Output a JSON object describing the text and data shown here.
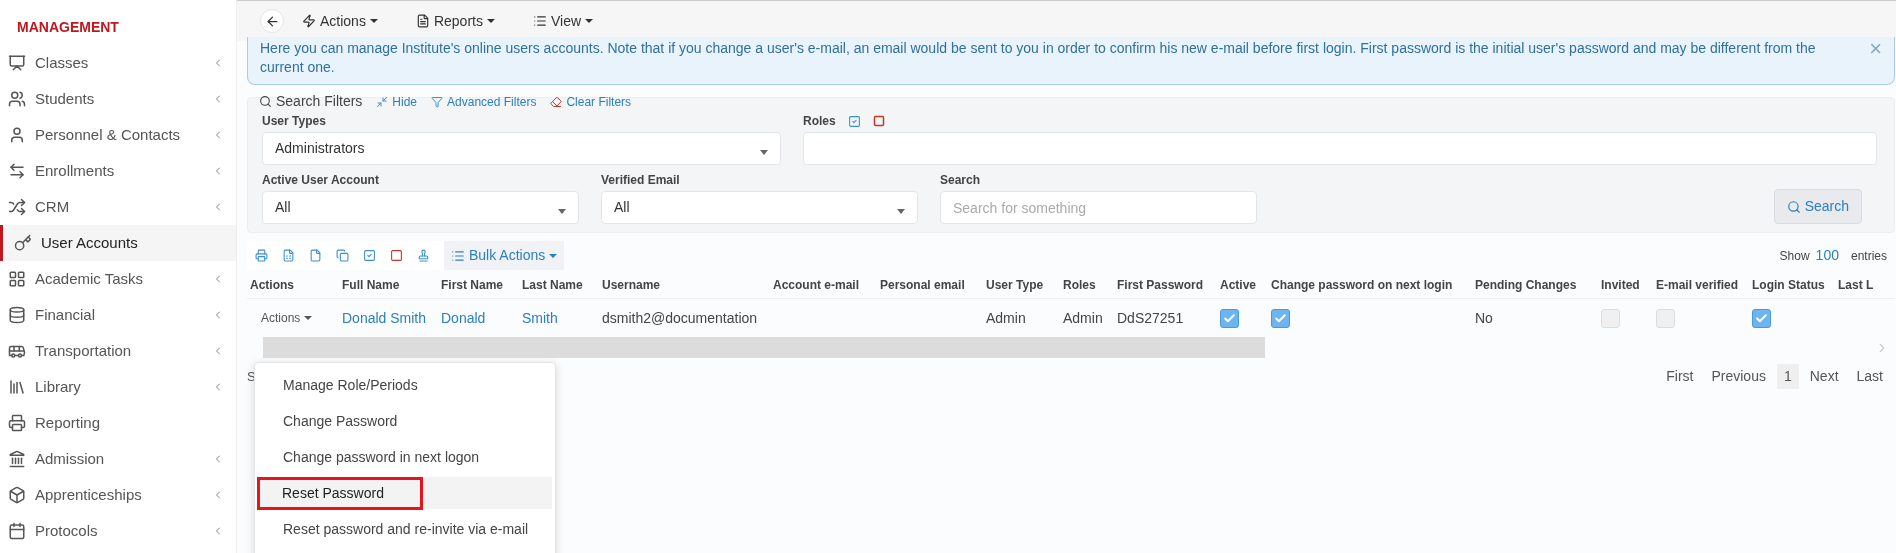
{
  "sidebar": {
    "heading": "MANAGEMENT",
    "items": [
      {
        "label": "Classes",
        "selected": false,
        "has_submenu": true
      },
      {
        "label": "Students",
        "selected": false,
        "has_submenu": true
      },
      {
        "label": "Personnel & Contacts",
        "selected": false,
        "has_submenu": true
      },
      {
        "label": "Enrollments",
        "selected": false,
        "has_submenu": true
      },
      {
        "label": "CRM",
        "selected": false,
        "has_submenu": true
      },
      {
        "label": "User Accounts",
        "selected": true,
        "has_submenu": false
      },
      {
        "label": "Academic Tasks",
        "selected": false,
        "has_submenu": true
      },
      {
        "label": "Financial",
        "selected": false,
        "has_submenu": true
      },
      {
        "label": "Transportation",
        "selected": false,
        "has_submenu": true
      },
      {
        "label": "Library",
        "selected": false,
        "has_submenu": true
      },
      {
        "label": "Reporting",
        "selected": false,
        "has_submenu": false
      },
      {
        "label": "Admission",
        "selected": false,
        "has_submenu": true
      },
      {
        "label": "Apprenticeships",
        "selected": false,
        "has_submenu": true
      },
      {
        "label": "Protocols",
        "selected": false,
        "has_submenu": true
      }
    ]
  },
  "toolbar": {
    "menus": [
      {
        "label": "Actions"
      },
      {
        "label": "Reports"
      },
      {
        "label": "View"
      }
    ]
  },
  "alert": {
    "text": "Here you can manage Institute's online users accounts. Note that if you change a user's e-mail, an email would be sent to you in order to confirm his new e-mail before first login. First password is the initial user's password and may be different from the current one.",
    "close": "×"
  },
  "filters": {
    "title": "Search Filters",
    "links": [
      {
        "label": "Hide"
      },
      {
        "label": "Advanced Filters"
      },
      {
        "label": "Clear Filters"
      }
    ],
    "fields": [
      {
        "label": "User Types",
        "kind": "select",
        "value": "Administrators"
      },
      {
        "label": "Roles",
        "kind": "roles"
      },
      {
        "label": "Active User Account",
        "kind": "select",
        "value": "All"
      },
      {
        "label": "Verified Email",
        "kind": "select",
        "value": "All"
      },
      {
        "label": "Search",
        "kind": "text",
        "placeholder": "Search for something"
      }
    ],
    "search_button": "Search"
  },
  "table_tools": {
    "bulk_actions": "Bulk Actions",
    "show_label": "Show",
    "page_size": "100",
    "entries_label": "entries"
  },
  "table": {
    "columns": [
      "Actions",
      "Full Name",
      "First Name",
      "Last Name",
      "Username",
      "Account e-mail",
      "Personal email",
      "User Type",
      "Roles",
      "First Password",
      "Active",
      "Change password on next login",
      "Pending Changes",
      "Invited",
      "E-mail verified",
      "Login Status",
      "Last L"
    ],
    "rows": [
      {
        "cells": [
          {
            "kind": "actions",
            "text": "Actions"
          },
          {
            "kind": "link",
            "text": "Donald Smith"
          },
          {
            "kind": "link",
            "text": "Donald"
          },
          {
            "kind": "link",
            "text": "Smith"
          },
          {
            "kind": "text",
            "text": "dsmith2@documentation"
          },
          {
            "kind": "empty"
          },
          {
            "kind": "empty"
          },
          {
            "kind": "text",
            "text": "Admin"
          },
          {
            "kind": "text",
            "text": "Admin"
          },
          {
            "kind": "text",
            "text": "DdS27251"
          },
          {
            "kind": "check",
            "checked": true
          },
          {
            "kind": "check",
            "checked": true
          },
          {
            "kind": "text",
            "text": "No"
          },
          {
            "kind": "check",
            "checked": false
          },
          {
            "kind": "check",
            "checked": false
          },
          {
            "kind": "check",
            "checked": true
          },
          {
            "kind": "empty"
          }
        ]
      }
    ]
  },
  "table_info": "S",
  "pagination": [
    {
      "label": "First",
      "selected": false
    },
    {
      "label": "Previous",
      "selected": false
    },
    {
      "label": "1",
      "selected": true
    },
    {
      "label": "Next",
      "selected": false
    },
    {
      "label": "Last",
      "selected": false
    }
  ],
  "action_menu": {
    "items": [
      {
        "label": "Manage Role/Periods",
        "highlighted": false
      },
      {
        "label": "Change Password",
        "highlighted": false
      },
      {
        "label": "Change password in next logon",
        "highlighted": false
      },
      {
        "label": "Reset Password",
        "highlighted": true
      },
      {
        "label": "Reset password and re-invite via e-mail",
        "highlighted": false
      }
    ]
  }
}
